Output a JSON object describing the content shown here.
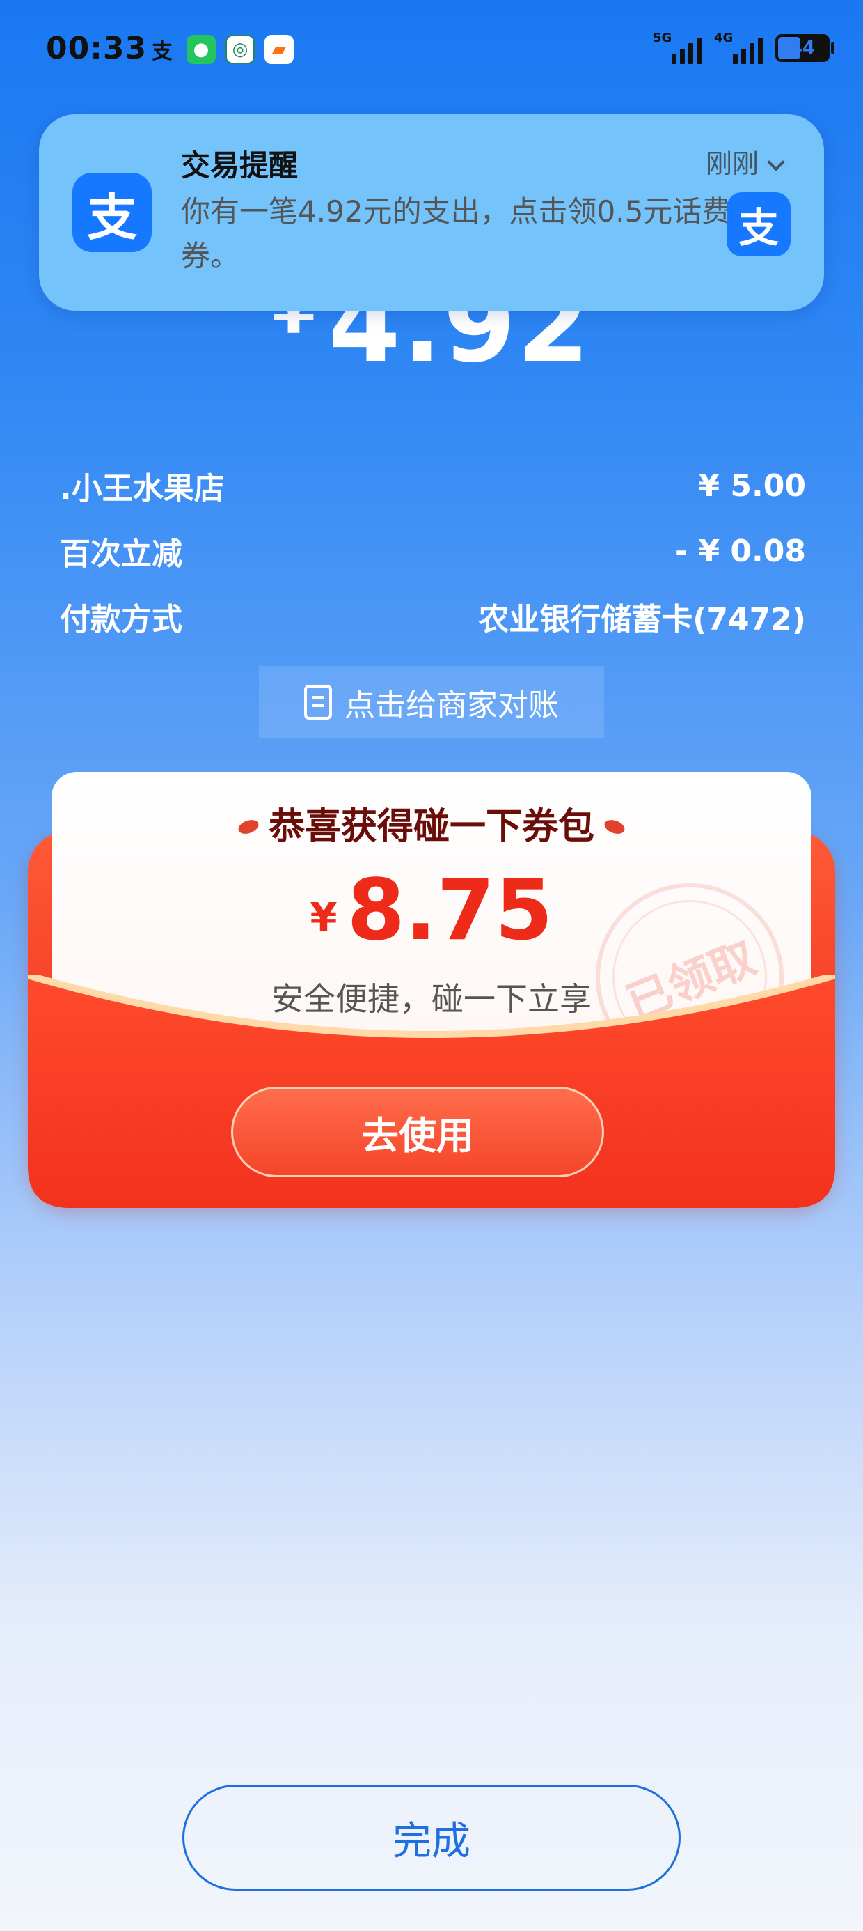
{
  "status_bar": {
    "time": "00:33",
    "notification_icons": [
      "alipay-icon",
      "wechat-icon",
      "bank-icon",
      "game-icon"
    ],
    "signal_1_label": "5G",
    "signal_2_label": "4G",
    "battery_level": "44"
  },
  "notification": {
    "app_icon_char": "支",
    "title": "交易提醒",
    "time": "刚刚",
    "body": "你有一笔4.92元的支出，点击领0.5元话费券。"
  },
  "payment": {
    "currency": "¥",
    "amount": "4.92"
  },
  "details": [
    {
      "label": ".小王水果店",
      "value": "¥ 5.00"
    },
    {
      "label": "百次立减",
      "value": "- ¥ 0.08"
    },
    {
      "label": "付款方式",
      "value": "农业银行储蓄卡(7472)"
    }
  ],
  "reconcile_label": "点击给商家对账",
  "coupon": {
    "title": "恭喜获得碰一下券包",
    "currency": "¥",
    "amount": "8.75",
    "subtitle": "安全便捷，碰一下立享",
    "stamp": "已领取",
    "use_button": "去使用"
  },
  "done_button": "完成",
  "colors": {
    "primary_blue": "#1677ff",
    "coupon_red": "#f43a22",
    "coupon_amount": "#ee2a18",
    "done_text": "#1e6fe0"
  }
}
